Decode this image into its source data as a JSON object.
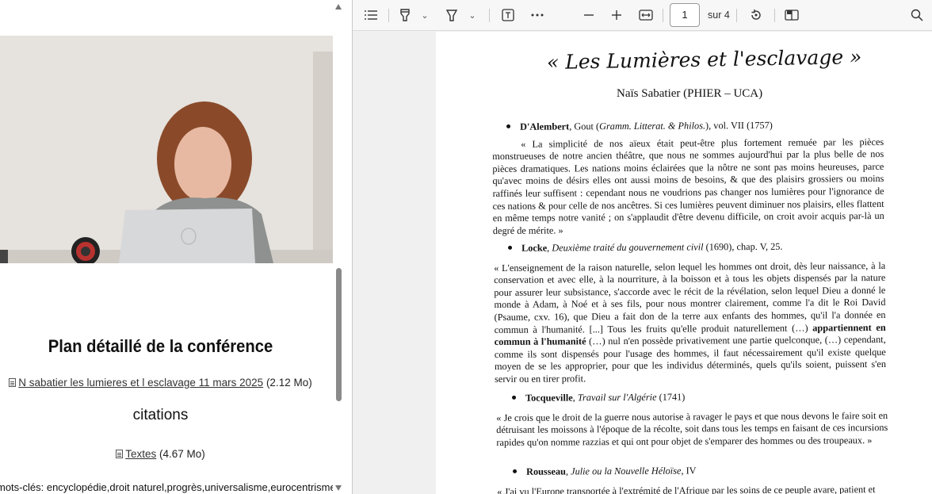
{
  "left": {
    "plan_title": "Plan détaillé de la conférence",
    "file1": {
      "link": "N sabatier les lumieres et l esclavage 11 mars 2025",
      "size": "(2.12 Mo)"
    },
    "citations": "citations",
    "file2": {
      "link": "Textes",
      "size": "(4.67 Mo)"
    },
    "keywords": "mots-clés: encyclopédie,droit naturel,progrès,universalisme,eurocentrisme."
  },
  "viewer": {
    "page_current": "1",
    "page_total": "sur 4",
    "icons": [
      "contents-icon",
      "draw-icon",
      "highlight-icon",
      "text-icon",
      "more-icon",
      "zoom-out-icon",
      "zoom-in-icon",
      "fit-width-icon",
      "rotate-icon",
      "two-page-icon",
      "search-icon"
    ]
  },
  "doc": {
    "title": "« Les Lumières et l'esclavage »",
    "author": "Naïs Sabatier (PHIER – UCA)",
    "s1": {
      "name": "D'Alembert",
      "rest": ", Gout (",
      "ital": "Gramm. Litterat. & Philos.",
      "tail": "), vol. VII (1757)",
      "quote": "« La simplicité de nos aïeux était peut-être plus fortement remuée par les pièces monstrueuses de notre ancien théâtre, que nous ne sommes aujourd'hui par la plus belle de nos pièces dramatiques. Les nations moins éclairées que la nôtre ne sont pas moins heureuses, parce qu'avec moins de désirs elles ont aussi moins de besoins, & que des plaisirs grossiers ou moins raffinés leur suffisent : cependant nous ne voudrions pas changer nos lumières pour l'ignorance de ces nations & pour celle de nos ancêtres. Si ces lumières peuvent diminuer nos plaisirs, elles flattent en même temps notre vanité ; on s'applaudit d'être devenu difficile, on croit avoir acquis par-là un degré de mérite. »"
    },
    "s2": {
      "name": "Locke",
      "ital": "Deuxième traité du gouvernement civil",
      "tail": " (1690), chap. V, 25.",
      "quote_a": "« L'enseignement de la raison naturelle, selon lequel les hommes ont droit, dès leur naissance, à la conservation et avec elle, à la nourriture, à la boisson et à tous les objets dispensés par la nature pour assurer leur subsistance, s'accorde avec le récit de la révélation, selon lequel Dieu a donné le monde à Adam, à Noé et à ses fils, pour nous montrer clairement, comme l'a dit le Roi David (Psaume, cxv. 16), que Dieu a fait don de la terre aux enfants des hommes, qu'il l'a donnée en commun à l'humanité. [...] Tous les fruits qu'elle produit naturellement (…) ",
      "quote_b": "appartiennent en commun à l'humanité",
      "quote_c": " (…) nul n'en possède privativement une partie quelconque, (…) cependant, comme ils sont dispensés pour l'usage des hommes, il faut nécessairement qu'il existe quelque moyen de se les approprier, pour que les individus déterminés, quels qu'ils soient, puissent s'en servir ou en tirer profit."
    },
    "s3": {
      "name": "Tocqueville",
      "ital": "Travail sur l'Algérie",
      "tail": " (1741)",
      "quote": "« Je crois que le droit de la guerre nous autorise à ravager le pays et que nous devons le faire soit en détruisant les moissons à l'époque de la récolte, soit dans tous les temps en faisant de ces incursions rapides qu'on nomme razzias et qui ont pour objet de s'emparer des hommes ou des troupeaux. »"
    },
    "s4": {
      "name": "Rousseau",
      "ital": "Julie ou la Nouvelle Héloïse",
      "tail": ", IV",
      "quote": "« J'ai vu l'Europe transportée à l'extrémité de l'Afrique par les soins de ce peuple avare, patient et"
    }
  }
}
